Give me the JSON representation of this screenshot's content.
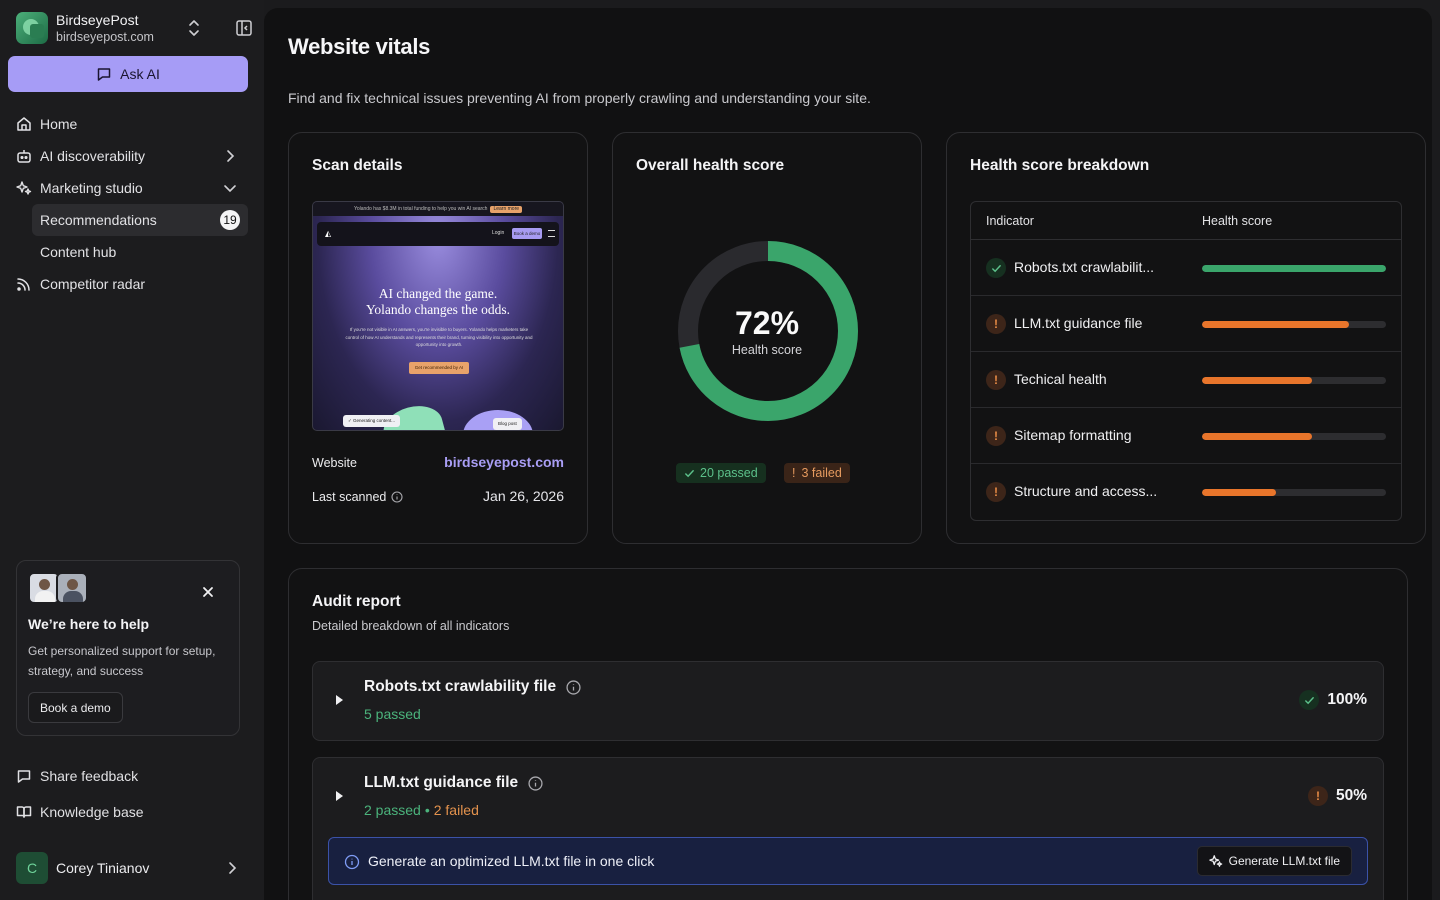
{
  "brand": {
    "name": "BirdseyePost",
    "domain": "birdseyepost.com"
  },
  "ask_ai": {
    "label": "Ask AI"
  },
  "nav": {
    "home": "Home",
    "ai_discoverability": "AI discoverability",
    "marketing_studio": "Marketing studio",
    "recommendations": "Recommendations",
    "recommendations_count": "19",
    "content_hub": "Content hub",
    "competitor_radar": "Competitor radar"
  },
  "help": {
    "title": "We’re here to help",
    "description": "Get personalized support for setup, strategy, and success",
    "button": "Book a demo"
  },
  "footer": {
    "share_feedback": "Share feedback",
    "knowledge_base": "Knowledge base",
    "user_initial": "C",
    "user_name": "Corey Tinianov"
  },
  "page": {
    "title": "Website vitals",
    "subtitle": "Find and fix technical issues preventing AI from properly crawling and understanding your site."
  },
  "scan": {
    "title": "Scan details",
    "website_label": "Website",
    "website_value": "birdseyepost.com",
    "last_scanned_label": "Last scanned",
    "last_scanned_value": "Jan 26, 2026",
    "preview": {
      "banner": "Yolando has $8.3M in total funding to help you win AI search",
      "banner_pill": "Learn more",
      "logo": "◭",
      "login": "Login",
      "cta": "Book a demo",
      "headline_1": "AI changed the game.",
      "headline_2": "Yolando changes the odds.",
      "body": "If you're not visible in AI answers, you're invisible to buyers. Yolando helps marketers take control of how AI understands and represents their brand, turning visibility into opportunity and opportunity into growth.",
      "button": "Get recommended by AI",
      "chip_1": "✓ Generating content...",
      "chip_2": "Blog post"
    }
  },
  "health": {
    "title": "Overall health score",
    "score": 72,
    "score_text": "72%",
    "score_label": "Health score",
    "passed": "20 passed",
    "failed": "3 failed",
    "colors": {
      "track": "#2a2a2e",
      "fill": "#3aa56b"
    }
  },
  "breakdown": {
    "title": "Health score breakdown",
    "col_indicator": "Indicator",
    "col_score": "Health score",
    "rows": [
      {
        "name": "Robots.txt crawlabilit...",
        "status": "ok",
        "value": 100,
        "color": "#3aa56b"
      },
      {
        "name": "LLM.txt guidance file",
        "status": "warn",
        "value": 80,
        "color": "#e8752b"
      },
      {
        "name": "Techical health",
        "status": "warn",
        "value": 60,
        "color": "#e8752b"
      },
      {
        "name": "Sitemap formatting",
        "status": "warn",
        "value": 60,
        "color": "#e8752b"
      },
      {
        "name": "Structure and access...",
        "status": "warn",
        "value": 40,
        "color": "#e8752b"
      }
    ]
  },
  "audit": {
    "title": "Audit report",
    "subtitle": "Detailed breakdown of all indicators",
    "items": [
      {
        "title": "Robots.txt crawlability file",
        "passed": "5 passed",
        "failed": "",
        "score": "100%",
        "status": "ok"
      },
      {
        "title": "LLM.txt guidance file",
        "passed": "2 passed",
        "failed": "2 failed",
        "score": "50%",
        "status": "warn"
      }
    ],
    "llm_banner": {
      "text": "Generate an optimized LLM.txt file in one click",
      "button": "Generate LLM.txt file"
    }
  }
}
